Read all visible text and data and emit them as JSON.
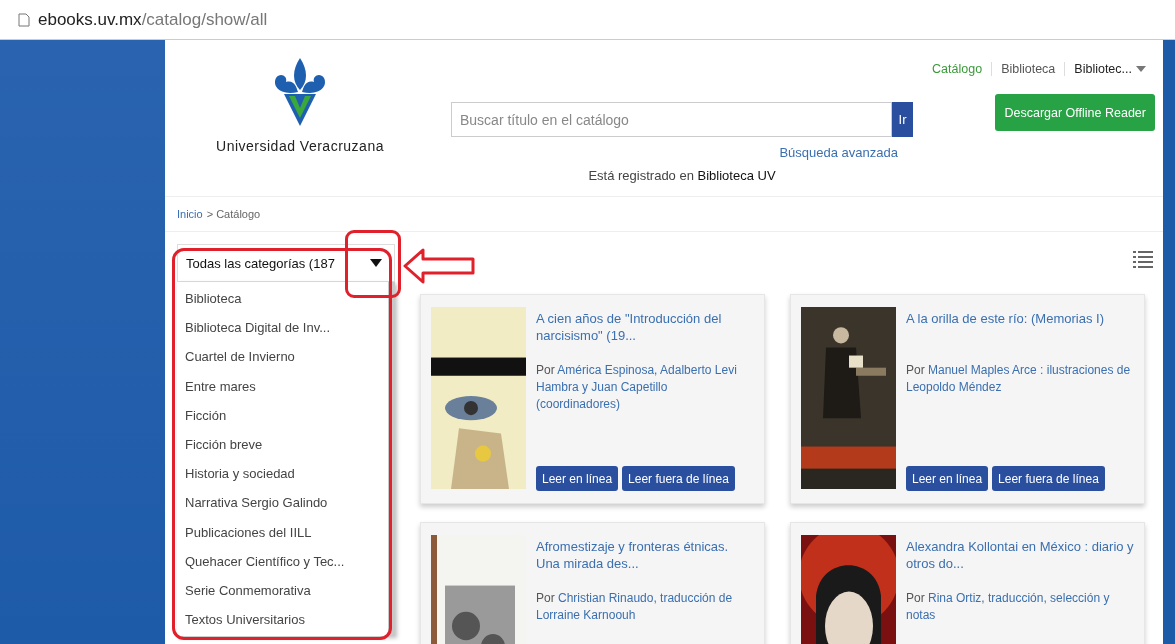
{
  "address_bar": {
    "host": "ebooks.uv.mx",
    "path": "/catalog/show/all"
  },
  "header": {
    "logo_text": "Universidad Veracruzana",
    "search": {
      "placeholder": "Buscar título en el catálogo",
      "button": "Ir"
    },
    "advanced_search": "Búsqueda avanzada",
    "registered": "Está registrado en **Biblioteca UV**",
    "nav": [
      {
        "label": "Catálogo",
        "selected": true,
        "dropdown": false
      },
      {
        "label": "Biblioteca",
        "selected": false,
        "dropdown": false
      },
      {
        "label": "Bibliotec...",
        "selected": false,
        "dropdown": true
      }
    ],
    "download_button": "Descargar Offline Reader"
  },
  "breadcrumb": [
    {
      "label": "Inicio",
      "link": true
    },
    {
      "label": "> Catálogo",
      "link": false
    }
  ],
  "category_dropdown": {
    "value": "Todas las categorías (187",
    "expanded": true,
    "options": [
      "Biblioteca",
      "Biblioteca Digital de Inv...",
      "Cuartel de Invierno",
      "Entre mares",
      "Ficción",
      "Ficción breve",
      "Historia y sociedad",
      "Narrativa Sergio Galindo",
      "Publicaciones del IILL",
      "Quehacer Científico y Tec...",
      "Serie Conmemorativa",
      "Textos Universitarios"
    ]
  },
  "books": [
    {
      "title": "A cien años de \"Introducción del narcisismo\" (19...",
      "by": "Por",
      "authors": "América Espinosa, Adalberto Levi Hambra y Juan Capetillo (coordinadores)",
      "cover": {
        "kind": "picture"
      },
      "buttons": [
        "Leer en línea",
        "Leer fuera de línea"
      ]
    },
    {
      "title": "A la orilla de este río: (Memorias I)",
      "by": "Por",
      "authors": "Manuel Maples Arce : ilustraciones de Leopoldo Méndez",
      "cover": {
        "kind": "picture"
      },
      "buttons": [
        "Leer en línea",
        "Leer fuera de línea"
      ]
    },
    {
      "title": "Afromestizaje y fronteras étnicas. Una mirada des...",
      "by": "Por",
      "authors": "Christian Rinaudo, traducción de Lorraine Karnoouh",
      "cover": {
        "kind": "picture"
      }
    },
    {
      "title": "Alexandra Kollontai en México : diario y otros do...",
      "by": "Por",
      "authors": "Rina Ortiz, traducción, selección y notas",
      "cover": {
        "kind": "picture"
      }
    }
  ]
}
